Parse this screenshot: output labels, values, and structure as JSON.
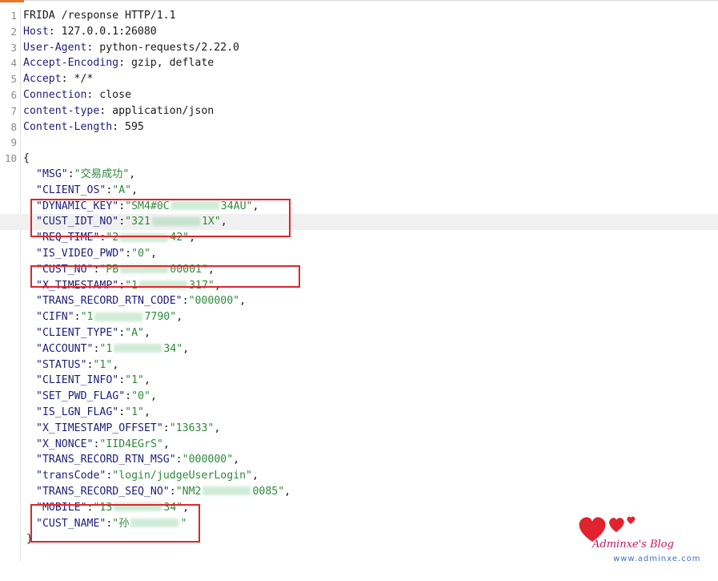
{
  "lines": [
    {
      "n": "1",
      "name": "",
      "value": "FRIDA /response HTTP/1.1"
    },
    {
      "n": "2",
      "name": "Host",
      "value": "127.0.0.1:26080"
    },
    {
      "n": "3",
      "name": "User-Agent",
      "value": "python-requests/2.22.0"
    },
    {
      "n": "4",
      "name": "Accept-Encoding",
      "value": "gzip, deflate"
    },
    {
      "n": "5",
      "name": "Accept",
      "value": "*/*"
    },
    {
      "n": "6",
      "name": "Connection",
      "value": "close"
    },
    {
      "n": "7",
      "name": "content-type",
      "value": "application/json"
    },
    {
      "n": "8",
      "name": "Content-Length",
      "value": "595"
    },
    {
      "n": "9",
      "name": "",
      "value": ""
    },
    {
      "n": "10",
      "name": "",
      "value": "{"
    }
  ],
  "json": [
    {
      "k": "\"MSG\"",
      "v": "\"交易成功\""
    },
    {
      "k": "\"CLIENT_OS\"",
      "v": "\"A\""
    },
    {
      "k": "\"DYNAMIC_KEY\"",
      "v": "\"SM4#0C",
      "v2": "34AU\""
    },
    {
      "k": "\"CUST_IDT_NO\"",
      "v": "\"321",
      "v2": "1X\""
    },
    {
      "k": "\"REQ_TIME\"",
      "v": "\"2",
      "v2": "42\""
    },
    {
      "k": "\"IS_VIDEO_PWD\"",
      "v": "\"0\""
    },
    {
      "k": "\"CUST_NO\"",
      "v": "\"PB",
      "v2": "00001\""
    },
    {
      "k": "\"X_TIMESTAMP\"",
      "v": "\"1",
      "v2": "317\""
    },
    {
      "k": "\"TRANS_RECORD_RTN_CODE\"",
      "v": "\"000000\""
    },
    {
      "k": "\"CIFN\"",
      "v": "\"1",
      "v2": "7790\""
    },
    {
      "k": "\"CLIENT_TYPE\"",
      "v": "\"A\""
    },
    {
      "k": "\"ACCOUNT\"",
      "v": "\"1",
      "v2": "34\""
    },
    {
      "k": "\"STATUS\"",
      "v": "\"1\""
    },
    {
      "k": "\"CLIENT_INFO\"",
      "v": "\"1\""
    },
    {
      "k": "\"SET_PWD_FLAG\"",
      "v": "\"0\""
    },
    {
      "k": "\"IS_LGN_FLAG\"",
      "v": "\"1\""
    },
    {
      "k": "\"X_TIMESTAMP_OFFSET\"",
      "v": "\"13633\""
    },
    {
      "k": "\"X_NONCE\"",
      "v": "\"IID4EGrS\""
    },
    {
      "k": "\"TRANS_RECORD_RTN_MSG\"",
      "v": "\"000000\""
    },
    {
      "k": "\"transCode\"",
      "v": "\"login/judgeUserLogin\""
    },
    {
      "k": "\"TRANS_RECORD_SEQ_NO\"",
      "v": "\"NM2",
      "v2": "0085\""
    },
    {
      "k": "\"MOBILE\"",
      "v": "\"13",
      "v2": "34\""
    },
    {
      "k": "\"CUST_NAME\"",
      "v": "\"孙",
      "v2": "\"",
      "last": true
    }
  ],
  "closing": "}",
  "watermark": {
    "brand": "Adminxe's Blog",
    "url": "www.adminxe.com",
    "colors": {
      "heart": "#e0232f",
      "text": "#c0185f",
      "url": "#3b6ed6"
    }
  },
  "colors": {
    "box": "#e0252b",
    "key": "#1e1e7a",
    "string": "#2e8b3a"
  }
}
